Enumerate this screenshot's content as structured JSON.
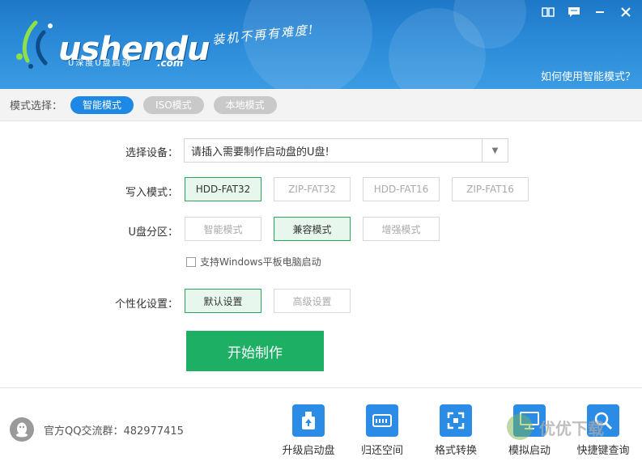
{
  "header": {
    "logo_main": "ushendu",
    "logo_sub": "U深度U盘启动",
    "logo_com": ".com",
    "slogan": "装机不再有难度!",
    "help_link": "如何使用智能模式？",
    "icons": [
      "book-icon",
      "message-icon",
      "minimize-icon",
      "close-icon"
    ]
  },
  "modebar": {
    "label": "模式选择：",
    "modes": [
      {
        "label": "智能模式",
        "active": true
      },
      {
        "label": "ISO模式",
        "active": false
      },
      {
        "label": "本地模式",
        "active": false
      }
    ]
  },
  "form": {
    "device": {
      "label": "选择设备：",
      "value": "请插入需要制作启动盘的U盘!"
    },
    "write_mode": {
      "label": "写入模式：",
      "options": [
        "HDD-FAT32",
        "ZIP-FAT32",
        "HDD-FAT16",
        "ZIP-FAT16"
      ],
      "selected": "HDD-FAT32"
    },
    "partition": {
      "label": "U盘分区：",
      "options": [
        "智能模式",
        "兼容模式",
        "增强模式"
      ],
      "selected": "兼容模式"
    },
    "tablet_checkbox": {
      "label": "支持Windows平板电脑启动",
      "checked": false
    },
    "personalize": {
      "label": "个性化设置：",
      "options": [
        "默认设置",
        "高级设置"
      ],
      "selected": "默认设置"
    },
    "start_button": "开始制作"
  },
  "footer": {
    "qq_group": "官方QQ交流群：482977415",
    "tools": [
      {
        "label": "升级启动盘",
        "icon": "upgrade-usb-icon"
      },
      {
        "label": "归还空间",
        "icon": "restore-space-icon"
      },
      {
        "label": "格式转换",
        "icon": "format-convert-icon"
      },
      {
        "label": "模拟启动",
        "icon": "simulate-boot-icon"
      },
      {
        "label": "快捷键查询",
        "icon": "hotkey-search-icon"
      }
    ],
    "watermark": "优优下载"
  },
  "colors": {
    "accent": "#1e88e5",
    "start": "#1db065",
    "selected_border": "#28a65a",
    "header": "#2a8ad8"
  }
}
